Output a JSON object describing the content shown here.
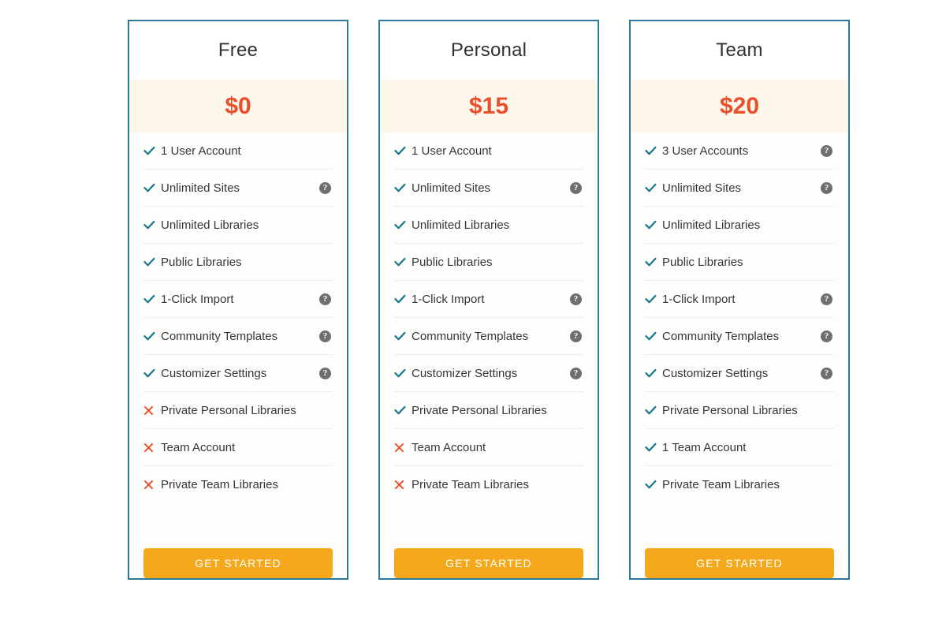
{
  "theme": {
    "card_border": "#2b7a9b",
    "price_band_bg": "#fdf6ea",
    "price_color": "#e8502b",
    "check_color": "#16788a",
    "cross_color": "#e8502b",
    "cta_bg": "#f6a81c",
    "help_icon_bg": "#6f6f6f",
    "divider": "#ececec",
    "text_color": "#333739"
  },
  "cta_label": "GET STARTED",
  "help_icon_glyph": "?",
  "plans": [
    {
      "name": "Free",
      "price": "$0",
      "cta": "GET STARTED",
      "features": [
        {
          "label": "1 User Account",
          "included": true,
          "help": false
        },
        {
          "label": "Unlimited Sites",
          "included": true,
          "help": true
        },
        {
          "label": "Unlimited Libraries",
          "included": true,
          "help": false
        },
        {
          "label": "Public Libraries",
          "included": true,
          "help": false
        },
        {
          "label": "1-Click Import",
          "included": true,
          "help": true
        },
        {
          "label": "Community Templates",
          "included": true,
          "help": true
        },
        {
          "label": "Customizer Settings",
          "included": true,
          "help": true
        },
        {
          "label": "Private Personal Libraries",
          "included": false,
          "help": false
        },
        {
          "label": "Team Account",
          "included": false,
          "help": false
        },
        {
          "label": "Private Team Libraries",
          "included": false,
          "help": false
        }
      ]
    },
    {
      "name": "Personal",
      "price": "$15",
      "cta": "GET STARTED",
      "features": [
        {
          "label": "1 User Account",
          "included": true,
          "help": false
        },
        {
          "label": "Unlimited Sites",
          "included": true,
          "help": true
        },
        {
          "label": "Unlimited Libraries",
          "included": true,
          "help": false
        },
        {
          "label": "Public Libraries",
          "included": true,
          "help": false
        },
        {
          "label": "1-Click Import",
          "included": true,
          "help": true
        },
        {
          "label": "Community Templates",
          "included": true,
          "help": true
        },
        {
          "label": "Customizer Settings",
          "included": true,
          "help": true
        },
        {
          "label": "Private Personal Libraries",
          "included": true,
          "help": false
        },
        {
          "label": "Team Account",
          "included": false,
          "help": false
        },
        {
          "label": "Private Team Libraries",
          "included": false,
          "help": false
        }
      ]
    },
    {
      "name": "Team",
      "price": "$20",
      "cta": "GET STARTED",
      "features": [
        {
          "label": "3 User Accounts",
          "included": true,
          "help": true
        },
        {
          "label": "Unlimited Sites",
          "included": true,
          "help": true
        },
        {
          "label": "Unlimited Libraries",
          "included": true,
          "help": false
        },
        {
          "label": "Public Libraries",
          "included": true,
          "help": false
        },
        {
          "label": "1-Click Import",
          "included": true,
          "help": true
        },
        {
          "label": "Community Templates",
          "included": true,
          "help": true
        },
        {
          "label": "Customizer Settings",
          "included": true,
          "help": true
        },
        {
          "label": "Private Personal Libraries",
          "included": true,
          "help": false
        },
        {
          "label": "1 Team Account",
          "included": true,
          "help": false
        },
        {
          "label": "Private Team Libraries",
          "included": true,
          "help": false
        }
      ]
    }
  ]
}
